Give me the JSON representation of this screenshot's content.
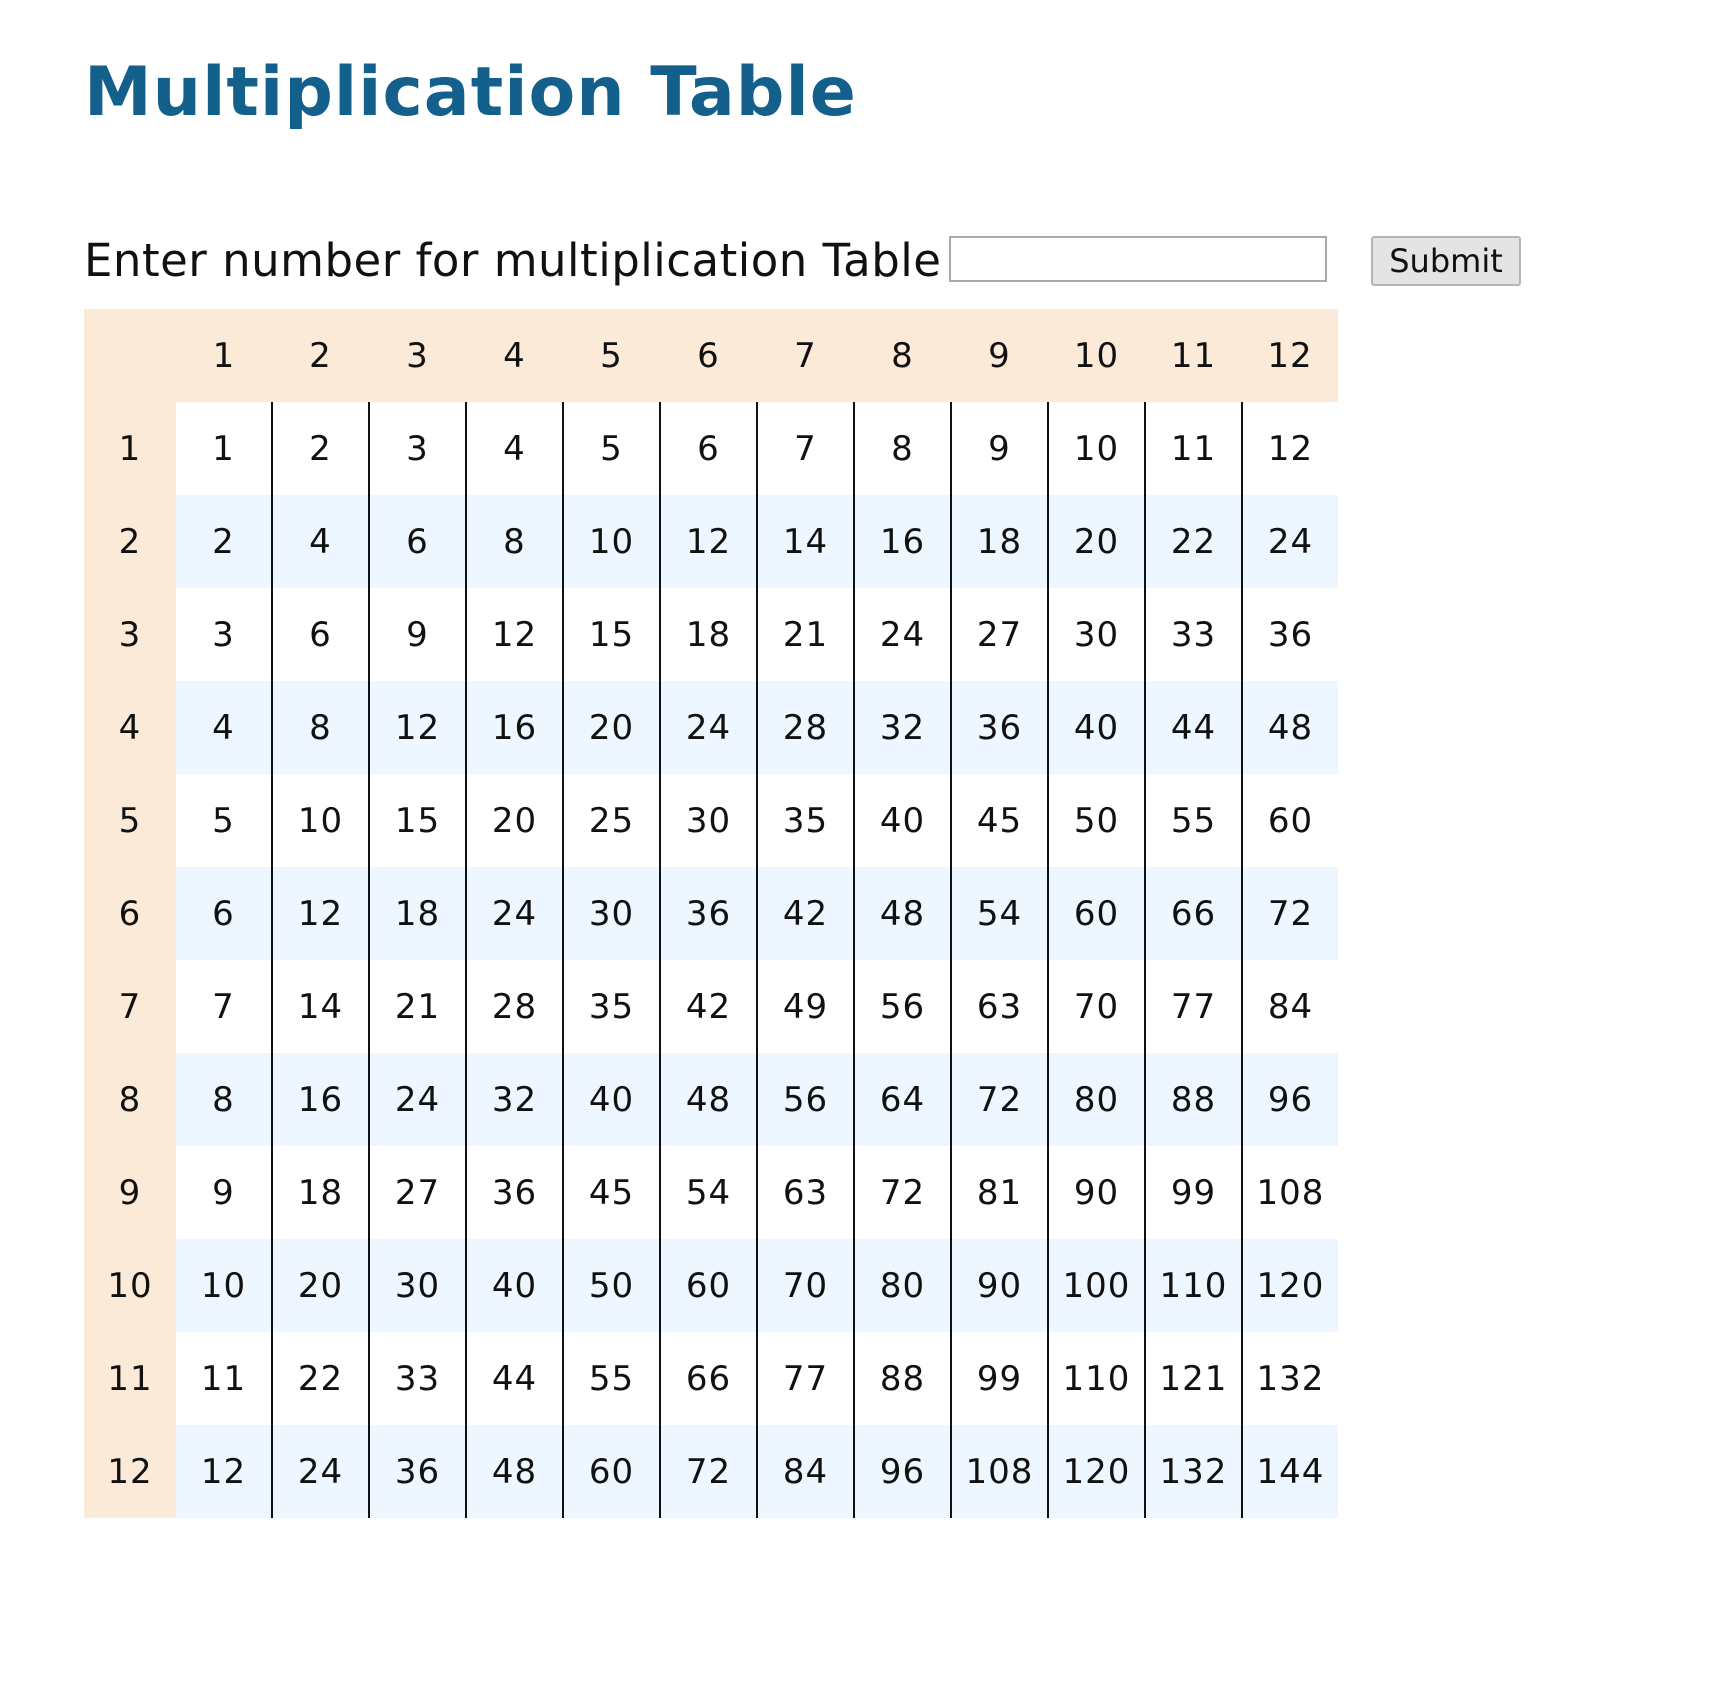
{
  "page": {
    "title": "Multiplication Table"
  },
  "form": {
    "label": "Enter number for multiplication Table :",
    "input_value": "",
    "submit_label": "Submit"
  },
  "table": {
    "column_headers": [
      "1",
      "2",
      "3",
      "4",
      "5",
      "6",
      "7",
      "8",
      "9",
      "10",
      "11",
      "12"
    ],
    "rows": [
      {
        "header": "1",
        "cells": [
          "1",
          "2",
          "3",
          "4",
          "5",
          "6",
          "7",
          "8",
          "9",
          "10",
          "11",
          "12"
        ]
      },
      {
        "header": "2",
        "cells": [
          "2",
          "4",
          "6",
          "8",
          "10",
          "12",
          "14",
          "16",
          "18",
          "20",
          "22",
          "24"
        ]
      },
      {
        "header": "3",
        "cells": [
          "3",
          "6",
          "9",
          "12",
          "15",
          "18",
          "21",
          "24",
          "27",
          "30",
          "33",
          "36"
        ]
      },
      {
        "header": "4",
        "cells": [
          "4",
          "8",
          "12",
          "16",
          "20",
          "24",
          "28",
          "32",
          "36",
          "40",
          "44",
          "48"
        ]
      },
      {
        "header": "5",
        "cells": [
          "5",
          "10",
          "15",
          "20",
          "25",
          "30",
          "35",
          "40",
          "45",
          "50",
          "55",
          "60"
        ]
      },
      {
        "header": "6",
        "cells": [
          "6",
          "12",
          "18",
          "24",
          "30",
          "36",
          "42",
          "48",
          "54",
          "60",
          "66",
          "72"
        ]
      },
      {
        "header": "7",
        "cells": [
          "7",
          "14",
          "21",
          "28",
          "35",
          "42",
          "49",
          "56",
          "63",
          "70",
          "77",
          "84"
        ]
      },
      {
        "header": "8",
        "cells": [
          "8",
          "16",
          "24",
          "32",
          "40",
          "48",
          "56",
          "64",
          "72",
          "80",
          "88",
          "96"
        ]
      },
      {
        "header": "9",
        "cells": [
          "9",
          "18",
          "27",
          "36",
          "45",
          "54",
          "63",
          "72",
          "81",
          "90",
          "99",
          "108"
        ]
      },
      {
        "header": "10",
        "cells": [
          "10",
          "20",
          "30",
          "40",
          "50",
          "60",
          "70",
          "80",
          "90",
          "100",
          "110",
          "120"
        ]
      },
      {
        "header": "11",
        "cells": [
          "11",
          "22",
          "33",
          "44",
          "55",
          "66",
          "77",
          "88",
          "99",
          "110",
          "121",
          "132"
        ]
      },
      {
        "header": "12",
        "cells": [
          "12",
          "24",
          "36",
          "48",
          "60",
          "72",
          "84",
          "96",
          "108",
          "120",
          "132",
          "144"
        ]
      }
    ]
  },
  "colors": {
    "title": "#13608d",
    "header_background": "#fbead7",
    "odd_row_background": "#ffffff",
    "even_row_background": "#eef6ff",
    "column_divider": "#111111"
  }
}
